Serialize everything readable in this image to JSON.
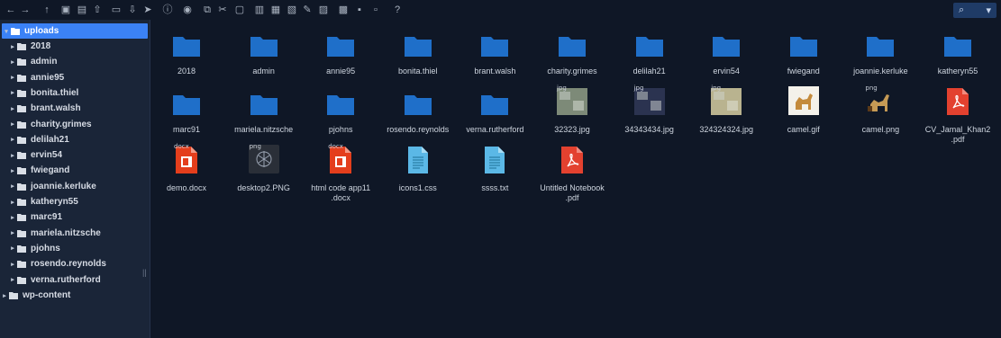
{
  "toolbar": {
    "buttons": [
      {
        "name": "back-icon",
        "glyph": "←"
      },
      {
        "name": "forward-icon",
        "glyph": "→"
      },
      {
        "name": "up-icon",
        "glyph": "↑"
      },
      {
        "name": "new-folder-icon",
        "glyph": "▣"
      },
      {
        "name": "new-file-icon",
        "glyph": "▤"
      },
      {
        "name": "upload-icon",
        "glyph": "⇧"
      },
      {
        "name": "open-folder-icon",
        "glyph": "▭"
      },
      {
        "name": "download-icon",
        "glyph": "⇩"
      },
      {
        "name": "select-icon",
        "glyph": "➤"
      },
      {
        "name": "info-icon",
        "glyph": "ⓘ"
      },
      {
        "name": "preview-icon",
        "glyph": "◉"
      },
      {
        "name": "copy-icon",
        "glyph": "⧉"
      },
      {
        "name": "cut-icon",
        "glyph": "✂"
      },
      {
        "name": "paste-icon",
        "glyph": "▢"
      },
      {
        "name": "delete-icon",
        "glyph": "▥"
      },
      {
        "name": "rename-icon",
        "glyph": "▦"
      },
      {
        "name": "duplicate-icon",
        "glyph": "▧"
      },
      {
        "name": "edit-icon",
        "glyph": "✎"
      },
      {
        "name": "resize-icon",
        "glyph": "▨"
      },
      {
        "name": "archive-icon",
        "glyph": "▩"
      },
      {
        "name": "extract-icon",
        "glyph": "▪"
      },
      {
        "name": "view-icon",
        "glyph": "▫"
      },
      {
        "name": "help-icon",
        "glyph": "?"
      }
    ],
    "search_icon": "⌕",
    "search_caret": "▾"
  },
  "sidebar": {
    "root": "uploads",
    "items": [
      "2018",
      "admin",
      "annie95",
      "bonita.thiel",
      "brant.walsh",
      "charity.grimes",
      "delilah21",
      "ervin54",
      "fwiegand",
      "joannie.kerluke",
      "katheryn55",
      "marc91",
      "mariela.nitzsche",
      "pjohns",
      "rosendo.reynolds",
      "verna.rutherford"
    ],
    "sibling": "wp-content",
    "splitter": "||"
  },
  "files": [
    {
      "label": "2018",
      "type": "folder"
    },
    {
      "label": "admin",
      "type": "folder"
    },
    {
      "label": "annie95",
      "type": "folder"
    },
    {
      "label": "bonita.thiel",
      "type": "folder"
    },
    {
      "label": "brant.walsh",
      "type": "folder"
    },
    {
      "label": "charity.grimes",
      "type": "folder"
    },
    {
      "label": "delilah21",
      "type": "folder"
    },
    {
      "label": "ervin54",
      "type": "folder"
    },
    {
      "label": "fwiegand",
      "type": "folder"
    },
    {
      "label": "joannie.kerluke",
      "type": "folder"
    },
    {
      "label": "katheryn55",
      "type": "folder"
    },
    {
      "label": "marc91",
      "type": "folder"
    },
    {
      "label": "mariela.nitzsche",
      "type": "folder"
    },
    {
      "label": "pjohns",
      "type": "folder"
    },
    {
      "label": "rosendo.reynolds",
      "type": "folder"
    },
    {
      "label": "verna.rutherford",
      "type": "folder"
    },
    {
      "label": "32323.jpg",
      "type": "jpg",
      "tag": "jpg",
      "thumb": "#7d8a78"
    },
    {
      "label": "34343434.jpg",
      "type": "jpg",
      "tag": "jpg",
      "thumb": "#2b3350"
    },
    {
      "label": "324324324.jpg",
      "type": "jpg",
      "tag": "jpg",
      "thumb": "#b9b38f"
    },
    {
      "label": "camel.gif",
      "type": "gif",
      "thumb": "#f4f1ea"
    },
    {
      "label": "camel.png",
      "type": "png",
      "tag": "png",
      "thumb": "#c59a55"
    },
    {
      "label": "CV_Jamal_Khan2.pdf",
      "label_lines": [
        "CV_Jamal_Khan2",
        ".pdf"
      ],
      "type": "pdf"
    },
    {
      "label": "demo.docx",
      "type": "docx",
      "tag": "docx"
    },
    {
      "label": "desktop2.PNG",
      "type": "png-dark",
      "tag": "png"
    },
    {
      "label": "html code app11.docx",
      "label_lines": [
        "html code app11",
        ".docx"
      ],
      "type": "docx",
      "tag": "docx"
    },
    {
      "label": "icons1.css",
      "type": "text"
    },
    {
      "label": "ssss.txt",
      "type": "text"
    },
    {
      "label": "Untitled Notebook.pdf",
      "label_lines": [
        "Untitled Notebook",
        ".pdf"
      ],
      "type": "pdf"
    }
  ],
  "colors": {
    "folder": "#1f6fc9",
    "selected": "#3b82f6",
    "pdf": "#e3412f",
    "docx": "#e43e1c",
    "text": "#5bb8e6"
  }
}
